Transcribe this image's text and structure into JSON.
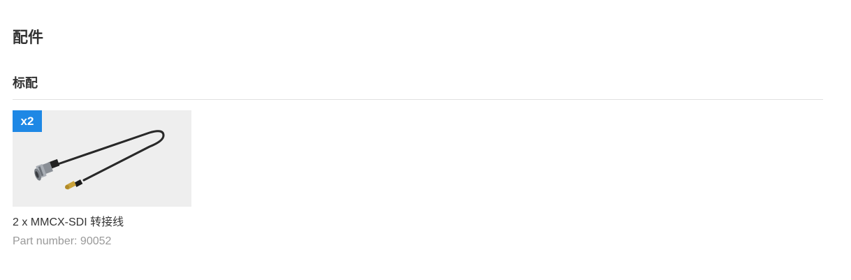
{
  "page": {
    "section_title": "配件",
    "subsection_title": "标配"
  },
  "accessories": [
    {
      "badge": "x2",
      "name": "2 x MMCX-SDI 转接线",
      "part_number": "Part number: 90052",
      "image_icon": "mmcx-sdi-cable-image"
    }
  ],
  "colors": {
    "badge_bg": "#1e88e5",
    "image_bg": "#eeeeee",
    "divider": "#e1e1e1",
    "muted_text": "#999999"
  }
}
